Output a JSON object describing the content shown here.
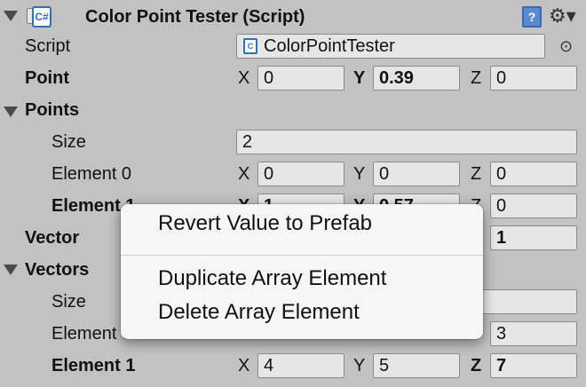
{
  "component": {
    "title": "Color Point Tester (Script)",
    "icon_glyph": "C#",
    "book_glyph": "?",
    "gear_glyph": "⚙▾"
  },
  "script_row": {
    "label": "Script",
    "value": "ColorPointTester",
    "picker_glyph": "⊙"
  },
  "point": {
    "label": "Point",
    "x": "0",
    "y": "0.39",
    "z": "0"
  },
  "points": {
    "label": "Points",
    "size_label": "Size",
    "size": "2",
    "element0": {
      "label": "Element 0",
      "x": "0",
      "y": "0",
      "z": "0"
    },
    "element1": {
      "label": "Element 1",
      "x": "1",
      "y": "0.57",
      "z": "0"
    }
  },
  "vector": {
    "label": "Vector",
    "z": "1"
  },
  "vectors": {
    "label": "Vectors",
    "size_label": "Size",
    "element0": {
      "label": "Element 0",
      "z": "3"
    },
    "element1": {
      "label": "Element 1",
      "x": "4",
      "y": "5",
      "z": "7"
    }
  },
  "axes": {
    "x": "X",
    "y": "Y",
    "z": "Z"
  },
  "context_menu": {
    "revert": "Revert Value to Prefab",
    "duplicate": "Duplicate Array Element",
    "delete": "Delete Array Element"
  }
}
